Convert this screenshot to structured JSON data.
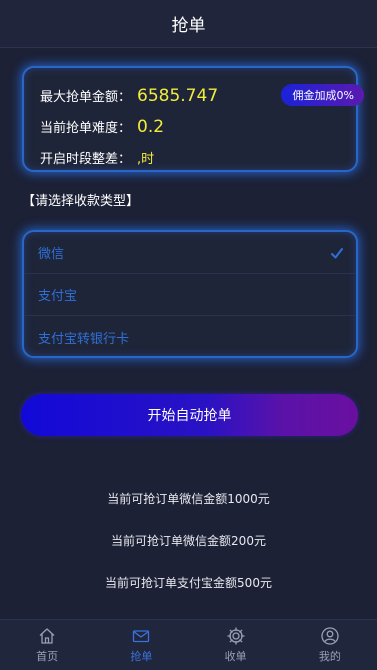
{
  "header": {
    "title": "抢单"
  },
  "info": {
    "max_amount_label": "最大抢单金额：",
    "max_amount_value": "6585.747",
    "difficulty_label": "当前抢单难度：",
    "difficulty_value": "0.2",
    "period_label": "开启时段整差：",
    "period_value": ",时",
    "badge": "佣金加成0%"
  },
  "payment": {
    "section_title": "【请选择收款类型】",
    "options": [
      {
        "label": "微信",
        "selected": true
      },
      {
        "label": "支付宝",
        "selected": false
      },
      {
        "label": "支付宝转银行卡",
        "selected": false
      }
    ]
  },
  "start_button": "开始自动抢单",
  "available": [
    "当前可抢订单微信金额1000元",
    "当前可抢订单微信金额200元",
    "当前可抢订单支付宝金额500元"
  ],
  "tabbar": {
    "items": [
      {
        "label": "首页",
        "icon": "home-icon"
      },
      {
        "label": "抢单",
        "icon": "mail-icon",
        "active": true
      },
      {
        "label": "收单",
        "icon": "gear-icon"
      },
      {
        "label": "我的",
        "icon": "user-icon"
      }
    ]
  },
  "colors": {
    "background": "#1c2136",
    "accent_blue": "#2f6fd8",
    "value_yellow": "#f2ec3b",
    "button_start": "#1209d8",
    "button_end": "#6a0fa0"
  }
}
